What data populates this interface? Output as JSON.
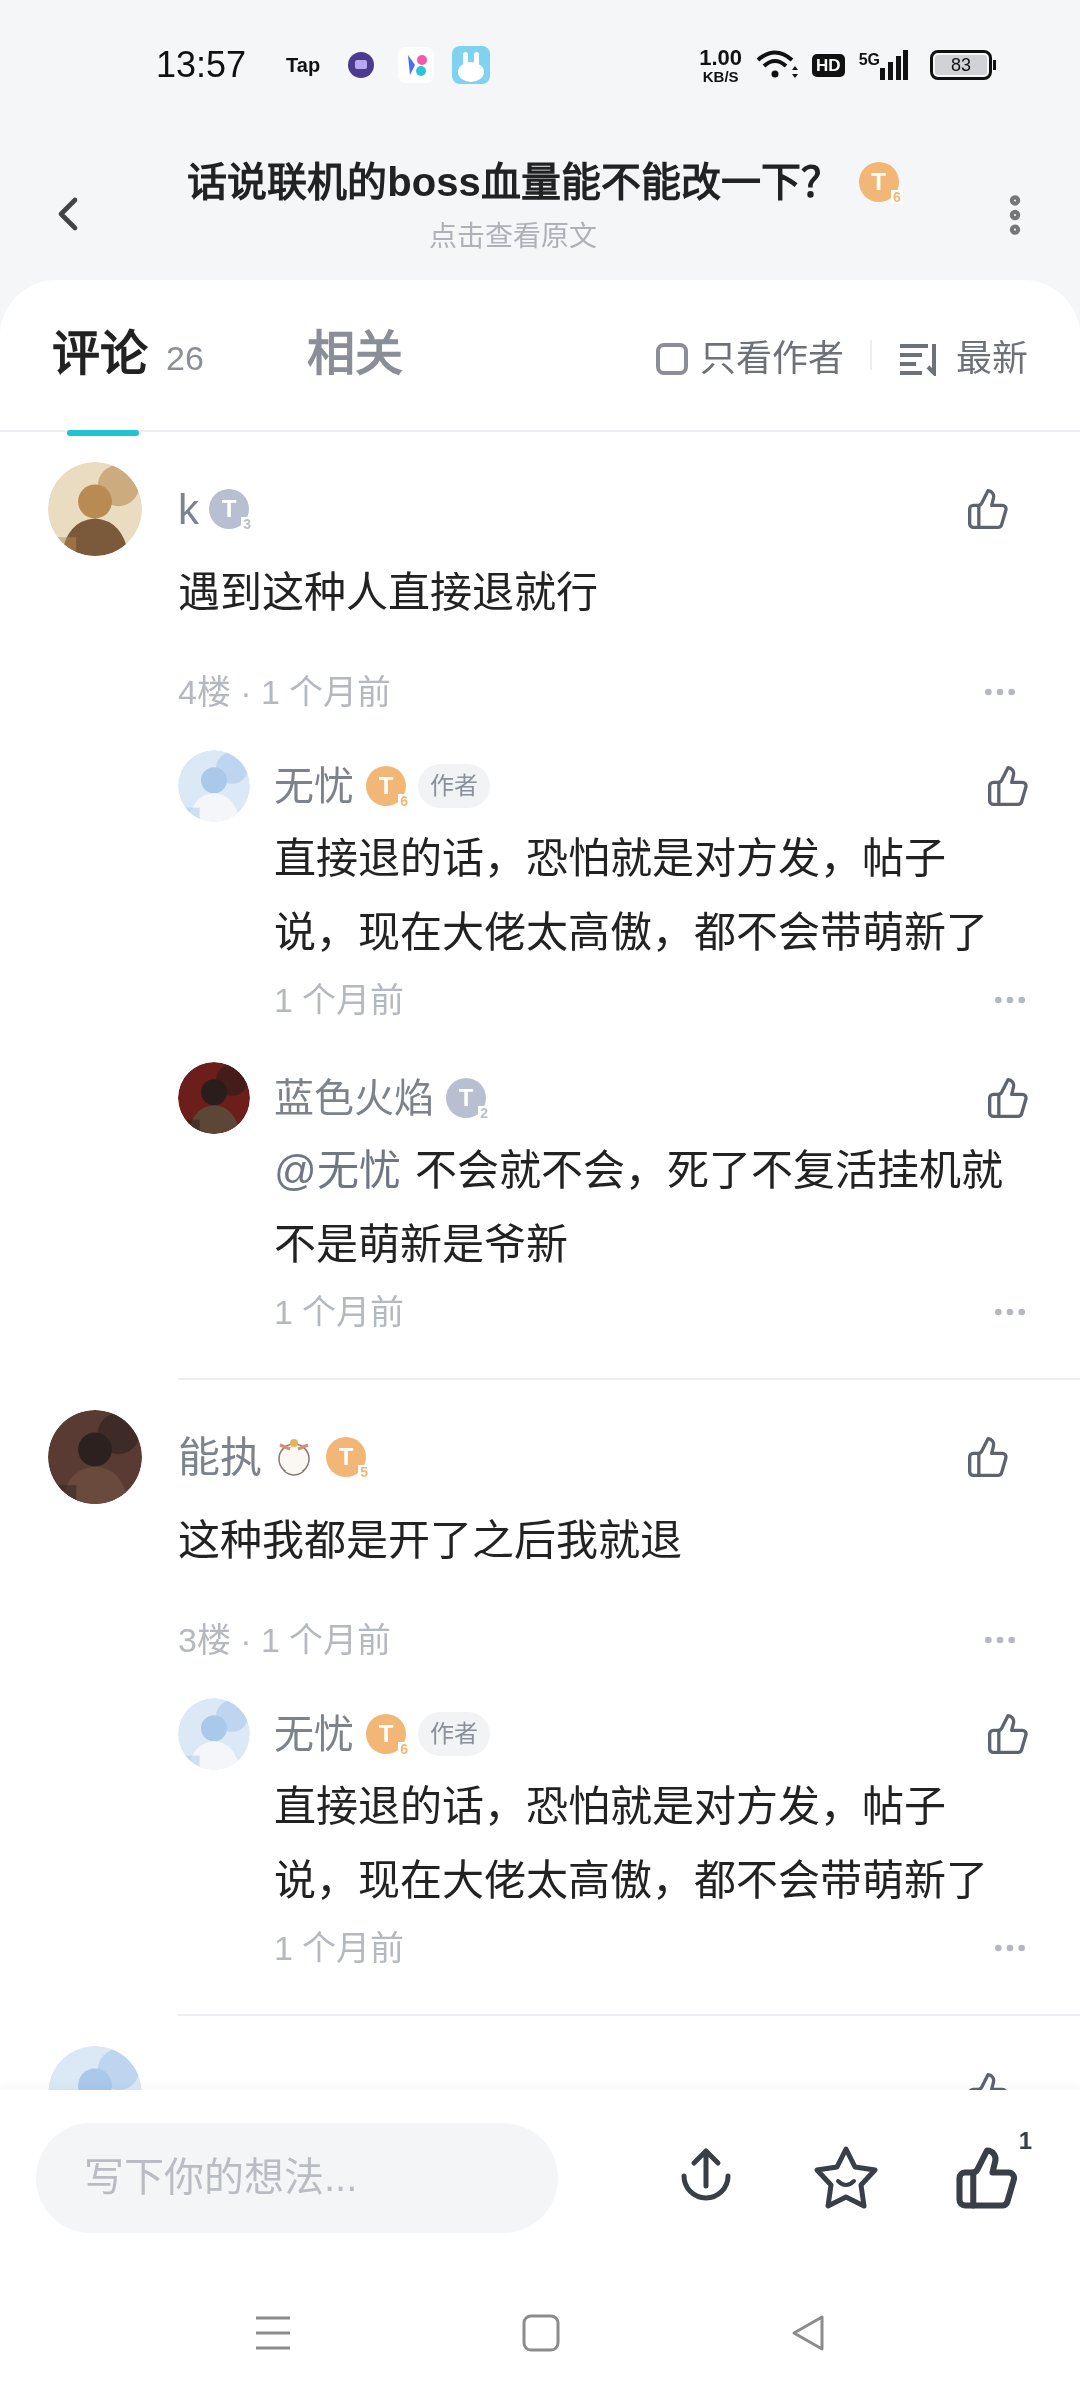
{
  "status_bar": {
    "time": "13:57",
    "app_label": "Tap",
    "net_speed": "1.00",
    "net_unit": "KB/S",
    "hd": "HD",
    "network": "5G",
    "battery": "83"
  },
  "header": {
    "title": "话说联机的boss血量能不能改一下？",
    "badge": {
      "letter": "T",
      "level": "6",
      "color": "#f2b777"
    },
    "subtitle": "点击查看原文"
  },
  "tabs": [
    {
      "label": "评论",
      "count": "26",
      "selected": true
    },
    {
      "label": "相关",
      "selected": false
    }
  ],
  "filter": {
    "label": "只看作者",
    "checked": false
  },
  "sort": {
    "label": "最新"
  },
  "comments": [
    {
      "name": "k",
      "badge": {
        "letter": "T",
        "level": "3",
        "color": "#b8bfd0"
      },
      "text": "遇到这种人直接退就行",
      "meta": "4楼 · 1 个月前",
      "replies": [
        {
          "name": "无忧",
          "badge": {
            "letter": "T",
            "level": "6",
            "color": "#f2b777"
          },
          "author_tag": "作者",
          "text": "直接退的话，恐怕就是对方发，帖子说，现在大佬太高傲，都不会带萌新了",
          "time": "1 个月前"
        },
        {
          "name": "蓝色火焰",
          "badge": {
            "letter": "T",
            "level": "2",
            "color": "#b8bfd0"
          },
          "mention": "@无忧",
          "text": "不会就不会，死了不复活挂机就不是萌新是爷新",
          "time": "1 个月前"
        }
      ]
    },
    {
      "name": "能执",
      "sticker": true,
      "badge": {
        "letter": "T",
        "level": "5",
        "color": "#f2b777"
      },
      "text": "这种我都是开了之后我就退",
      "meta": "3楼 · 1 个月前",
      "replies": [
        {
          "name": "无忧",
          "badge": {
            "letter": "T",
            "level": "6",
            "color": "#f2b777"
          },
          "author_tag": "作者",
          "text": "直接退的话，恐怕就是对方发，帖子说，现在大佬太高傲，都不会带萌新了",
          "time": "1 个月前"
        }
      ]
    }
  ],
  "composer": {
    "placeholder": "写下你的想法..."
  },
  "like_count": "1"
}
